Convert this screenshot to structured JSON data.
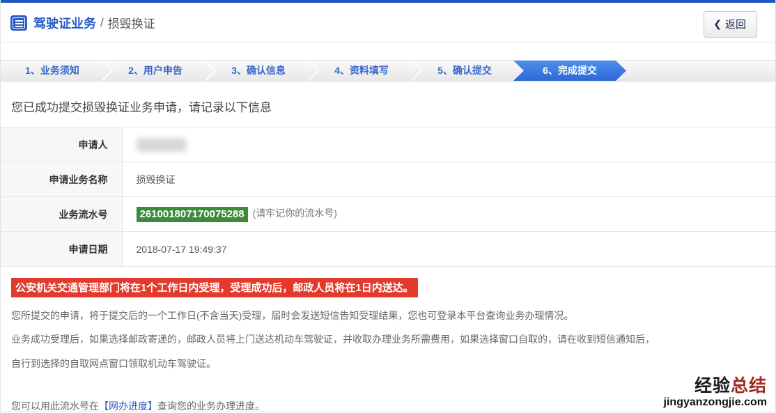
{
  "header": {
    "title_primary": "驾驶证业务",
    "title_separator": "/",
    "title_secondary": "损毁换证",
    "back_chevron": "❮",
    "back_label": "返回"
  },
  "steps": {
    "items": [
      {
        "label": "1、业务须知",
        "active": false
      },
      {
        "label": "2、用户申告",
        "active": false
      },
      {
        "label": "3、确认信息",
        "active": false
      },
      {
        "label": "4、资料填写",
        "active": false
      },
      {
        "label": "5、确认提交",
        "active": false
      },
      {
        "label": "6、完成提交",
        "active": true
      }
    ]
  },
  "main": {
    "success_message": "您已成功提交损毁换证业务申请，请记录以下信息",
    "info_table": {
      "rows": [
        {
          "label": "申请人",
          "value": "",
          "redacted": true
        },
        {
          "label": "申请业务名称",
          "value": "损毁换证"
        },
        {
          "label": "业务流水号",
          "value": "261001807170075288",
          "note": "(请牢记你的流水号)"
        },
        {
          "label": "申请日期",
          "value": "2018-07-17 19:49:37"
        }
      ]
    },
    "warning": "公安机关交通管理部门将在1个工作日内受理，受理成功后，邮政人员将在1日内送达。",
    "paragraphs": [
      "您所提交的申请，将于提交后的一个工作日(不含当天)受理，届时会发送短信告知受理结果，您也可登录本平台查询业务办理情况。",
      "业务成功受理后，如果选择邮政寄递的，邮政人员将上门送达机动车驾驶证，并收取办理业务所需费用，如果选择窗口自取的，请在收到短信通知后，",
      "自行到选择的自取网点窗口领取机动车驾驶证。"
    ],
    "progress_hint": {
      "prefix": "您可以用此流水号在",
      "link": "【网办进度】",
      "suffix": "查询您的业务办理进度。"
    }
  },
  "watermark": {
    "cn_black": "经验",
    "cn_red": "总结",
    "domain": "jingyanzongjie.com"
  },
  "colors": {
    "brand_blue": "#2057c0",
    "step_active_blue": "#2c68d8",
    "serial_green": "#3c8a3c",
    "warning_red": "#e23b2e",
    "link_blue": "#2d5bb8"
  }
}
